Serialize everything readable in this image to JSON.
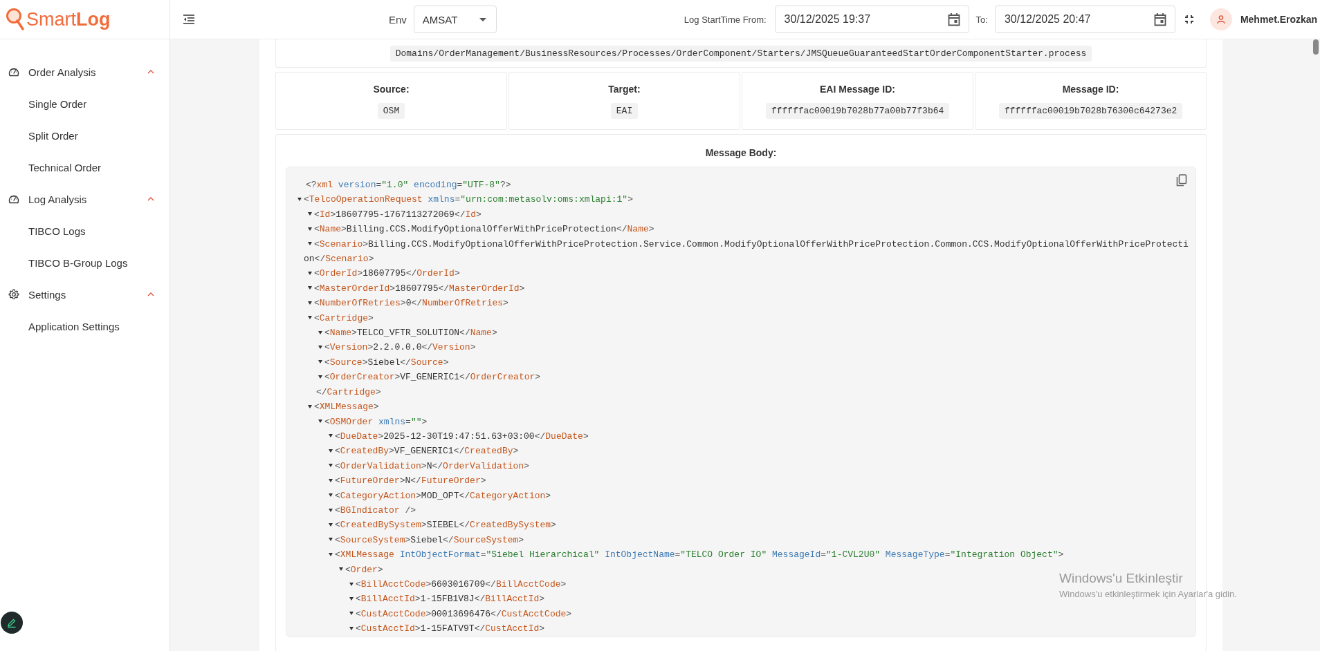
{
  "logo": "Smart**Log**",
  "sidebar": {
    "groups": [
      {
        "kind": "analysis",
        "label": "Order Analysis",
        "expanded": true,
        "items": [
          {
            "label": "Single Order",
            "selected": false
          },
          {
            "label": "Split Order",
            "selected": false
          },
          {
            "label": "Technical Order",
            "selected": false
          }
        ]
      },
      {
        "kind": "analysis",
        "label": "Log Analysis",
        "expanded": true,
        "items": [
          {
            "label": "TIBCO Logs",
            "selected": false
          },
          {
            "label": "TIBCO B-Group Logs",
            "selected": false
          }
        ]
      },
      {
        "kind": "settings",
        "label": "Settings",
        "expanded": true,
        "items": [
          {
            "label": "Application Settings",
            "selected": false
          }
        ]
      }
    ]
  },
  "topbar": {
    "env_label": "Env",
    "env_value": "AMSAT",
    "from_label": "Log StartTime From:",
    "from_value": "30/12/2025 19:37",
    "to_label": "To:",
    "to_value": "30/12/2025 20:47",
    "user": "Mehmet.Erozkan"
  },
  "path": "Domains/OrderManagement/BusinessResources/Processes/OrderComponent/Starters/JMSQueueGuaranteedStartOrderComponentStarter.process",
  "info": [
    {
      "label": "Source:",
      "value": "OSM"
    },
    {
      "label": "Target:",
      "value": "EAI"
    },
    {
      "label": "EAI Message ID:",
      "value": "ffffffac00019b7028b77a00b77f3b64"
    },
    {
      "label": "Message ID:",
      "value": "ffffffac00019b7028b76300c64273e2"
    }
  ],
  "body_label": "Message Body:",
  "xml": [
    {
      "kind": "declaration",
      "open": "<?xml version=\"1.0\" encoding=\"UTF-8\"?>"
    },
    {
      "kind": "element",
      "open": "<TelcoOperationRequest xmlns=\"urn:com:metasolv:oms:xmlapi:1\">",
      "expanded": true,
      "children": [
        {
          "kind": "element",
          "open": "<Id>",
          "text": "18607795-1767113272069",
          "close": "</Id>",
          "expanded": true
        },
        {
          "kind": "element",
          "open": "<Name>",
          "text": "Billing.CCS.ModifyOptionalOfferWithPriceProtection",
          "close": "</Name>",
          "expanded": true
        },
        {
          "kind": "element",
          "open": "<Scenario>",
          "text": "Billing.CCS.ModifyOptionalOfferWithPriceProtection.Service.Common.ModifyOptionalOfferWithPriceProtection.Common.CCS.ModifyOptionalOfferWithPriceProtection",
          "close": "</Scenario>",
          "expanded": true
        },
        {
          "kind": "element",
          "open": "<OrderId>",
          "text": "18607795",
          "close": "</OrderId>",
          "expanded": true
        },
        {
          "kind": "element",
          "open": "<MasterOrderId>",
          "text": "18607795",
          "close": "</MasterOrderId>",
          "expanded": true
        },
        {
          "kind": "element",
          "open": "<NumberOfRetries>",
          "text": "0",
          "close": "</NumberOfRetries>",
          "expanded": true
        },
        {
          "kind": "element",
          "open": "<Cartridge>",
          "close": "</Cartridge>",
          "expanded": true,
          "children": [
            {
              "kind": "element",
              "open": "<Name>",
              "text": "TELCO_VFTR_SOLUTION",
              "close": "</Name>",
              "expanded": true
            },
            {
              "kind": "element",
              "open": "<Version>",
              "text": "2.2.0.0.0",
              "close": "</Version>",
              "expanded": true
            },
            {
              "kind": "element",
              "open": "<Source>",
              "text": "Siebel",
              "close": "</Source>",
              "expanded": true
            },
            {
              "kind": "element",
              "open": "<OrderCreator>",
              "text": "VF_GENERIC1",
              "close": "</OrderCreator>",
              "expanded": true
            }
          ]
        },
        {
          "kind": "element",
          "open": "<XMLMessage>",
          "expanded": true,
          "children": [
            {
              "kind": "element",
              "open": "<OSMOrder xmlns=\"\">",
              "expanded": true,
              "children": [
                {
                  "kind": "element",
                  "open": "<DueDate>",
                  "text": "2025-12-30T19:47:51.63+03:00",
                  "close": "</DueDate>",
                  "expanded": true
                },
                {
                  "kind": "element",
                  "open": "<CreatedBy>",
                  "text": "VF_GENERIC1",
                  "close": "</CreatedBy>",
                  "expanded": true
                },
                {
                  "kind": "element",
                  "open": "<OrderValidation>",
                  "text": "N",
                  "close": "</OrderValidation>",
                  "expanded": true
                },
                {
                  "kind": "element",
                  "open": "<FutureOrder>",
                  "text": "N",
                  "close": "</FutureOrder>",
                  "expanded": true
                },
                {
                  "kind": "element",
                  "open": "<CategoryAction>",
                  "text": "MOD_OPT",
                  "close": "</CategoryAction>",
                  "expanded": true
                },
                {
                  "kind": "element",
                  "open": "<BGIndicator />",
                  "expanded": true
                },
                {
                  "kind": "element",
                  "open": "<CreatedBySystem>",
                  "text": "SIEBEL",
                  "close": "</CreatedBySystem>",
                  "expanded": true
                },
                {
                  "kind": "element",
                  "open": "<SourceSystem>",
                  "text": "Siebel",
                  "close": "</SourceSystem>",
                  "expanded": true
                },
                {
                  "kind": "element",
                  "open": "<XMLMessage IntObjectFormat=\"Siebel Hierarchical\" IntObjectName=\"TELCO Order IO\" MessageId=\"1-CVL2U0\" MessageType=\"Integration Object\">",
                  "expanded": true,
                  "children": [
                    {
                      "kind": "element",
                      "open": "<Order>",
                      "expanded": true,
                      "children": [
                        {
                          "kind": "element",
                          "open": "<BillAcctCode>",
                          "text": "6603016709",
                          "close": "</BillAcctCode>",
                          "expanded": true
                        },
                        {
                          "kind": "element",
                          "open": "<BillAcctId>",
                          "text": "1-15FB1V8J",
                          "close": "</BillAcctId>",
                          "expanded": true
                        },
                        {
                          "kind": "element",
                          "open": "<CustAcctCode>",
                          "text": "00013696476",
                          "close": "</CustAcctCode>",
                          "expanded": true
                        },
                        {
                          "kind": "element",
                          "open": "<CustAcctId>",
                          "text": "1-15FATV9T",
                          "close": "</CustAcctId>",
                          "expanded": true
                        }
                      ]
                    }
                  ]
                }
              ]
            }
          ]
        }
      ]
    }
  ],
  "os_notice": {
    "title": "Windows'u Etkinleştir",
    "subtitle": "Windows'u etkinleştirmek için Ayarlar'a gidin."
  }
}
